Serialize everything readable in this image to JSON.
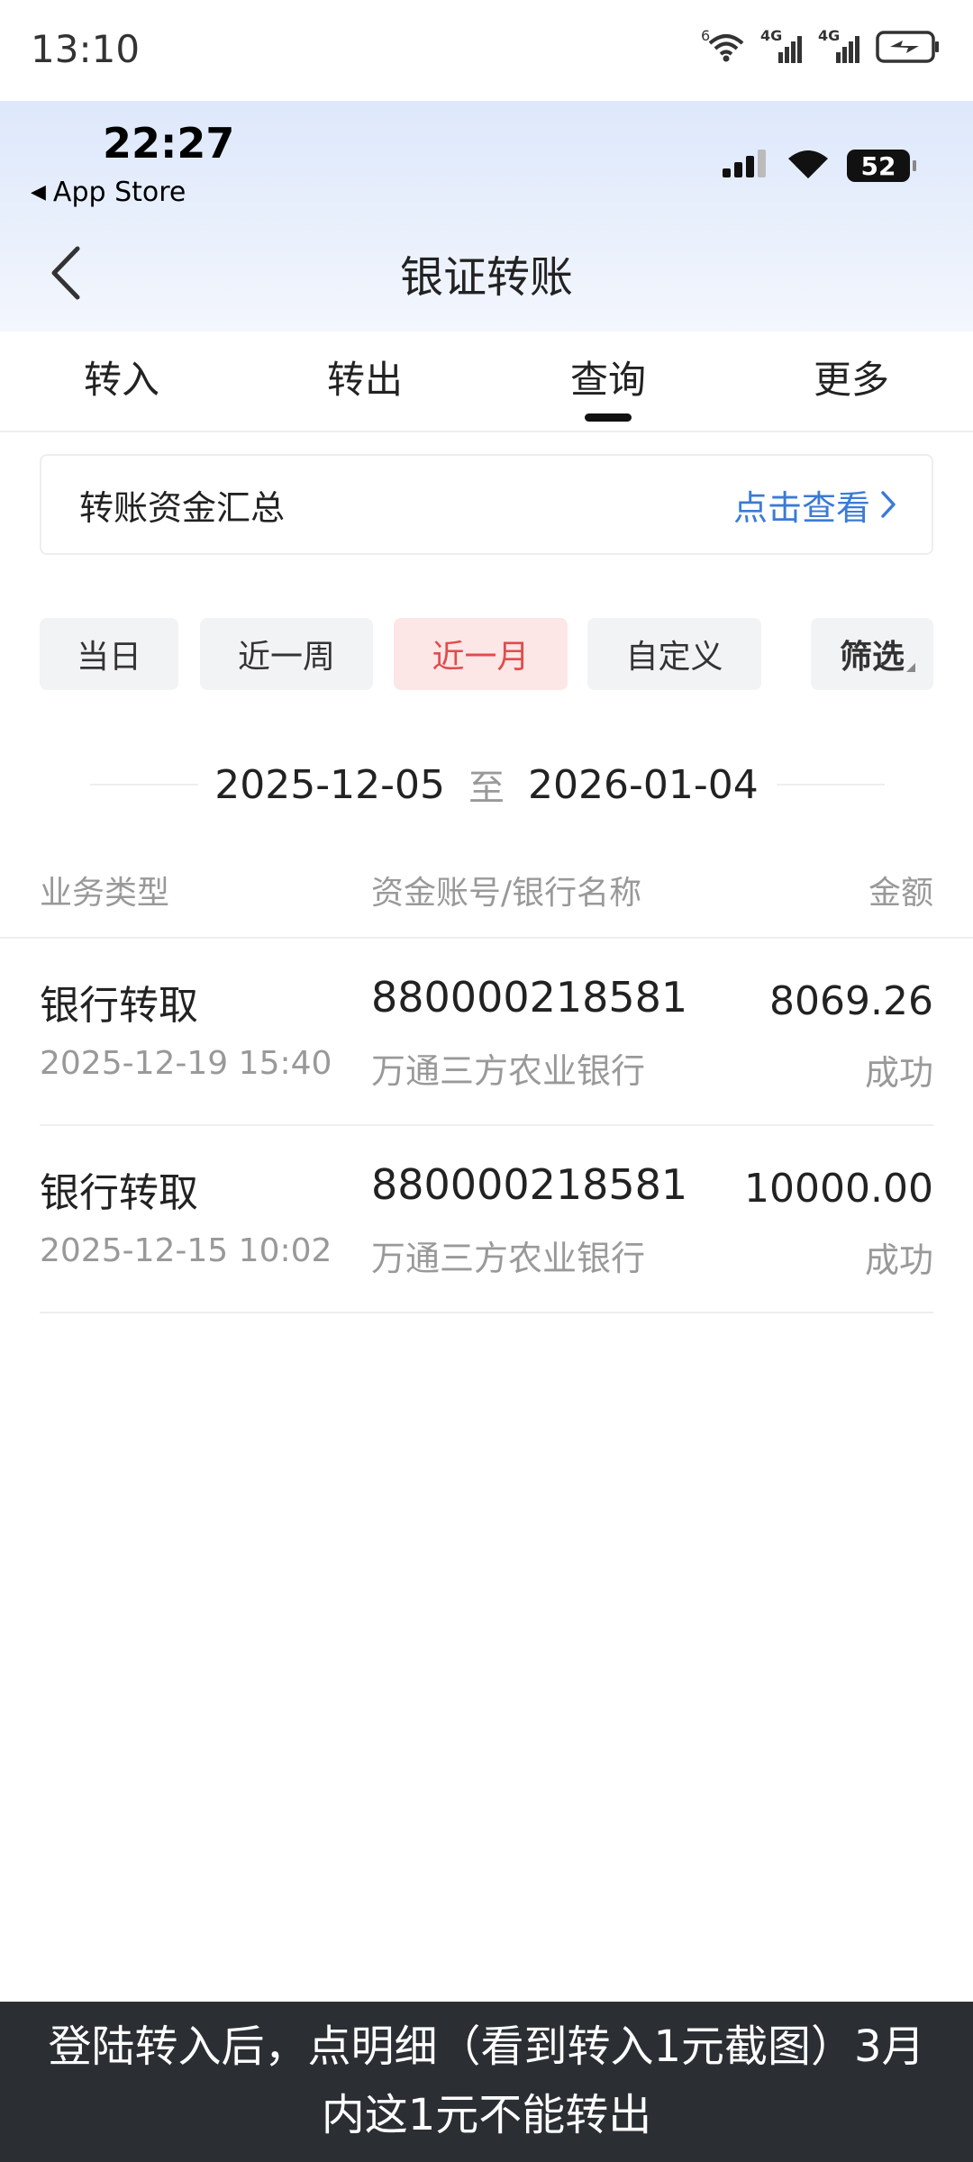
{
  "outer_status": {
    "time": "13:10",
    "wifi_badge": "6",
    "signal1_label": "4G",
    "signal2_label": "4G",
    "icons": [
      "wifi-icon",
      "signal-icon",
      "signal-icon",
      "battery-charging-icon"
    ]
  },
  "inner_status": {
    "time": "22:27",
    "back_app": "App Store",
    "battery": "52",
    "icons": [
      "cellular-icon",
      "wifi-icon",
      "battery-icon"
    ]
  },
  "nav": {
    "title": "银证转账",
    "back_icon": "chevron-left-icon"
  },
  "tabs": [
    {
      "label": "转入",
      "active": false
    },
    {
      "label": "转出",
      "active": false
    },
    {
      "label": "查询",
      "active": true
    },
    {
      "label": "更多",
      "active": false
    }
  ],
  "summary": {
    "title": "转账资金汇总",
    "link": "点击查看"
  },
  "filters": [
    {
      "label": "当日",
      "active": false
    },
    {
      "label": "近一周",
      "active": false
    },
    {
      "label": "近一月",
      "active": true
    },
    {
      "label": "自定义",
      "active": false
    },
    {
      "label": "筛选",
      "active": false
    }
  ],
  "date_range": {
    "start": "2025-12-05",
    "separator": "至",
    "end": "2026-01-04"
  },
  "table": {
    "headers": [
      "业务类型",
      "资金账号/银行名称",
      "金额"
    ],
    "rows": [
      {
        "type": "银行转取",
        "datetime": "2025-12-19 15:40",
        "account": "880000218581",
        "bank": "万通三方农业银行",
        "amount": "8069.26",
        "status": "成功"
      },
      {
        "type": "银行转取",
        "datetime": "2025-12-15 10:02",
        "account": "880000218581",
        "bank": "万通三方农业银行",
        "amount": "10000.00",
        "status": "成功"
      }
    ]
  },
  "caption": {
    "line1": "登陆转入后，点明细（看到转入1元截图）3月",
    "line2": "内这1元不能转出"
  },
  "colors": {
    "accent_red": "#e14c4c",
    "active_chip_bg": "#fde6e6",
    "link_blue": "#3a7bd5",
    "header_gradient_top": "#dde8fb",
    "caption_bg": "#2b2f33"
  }
}
